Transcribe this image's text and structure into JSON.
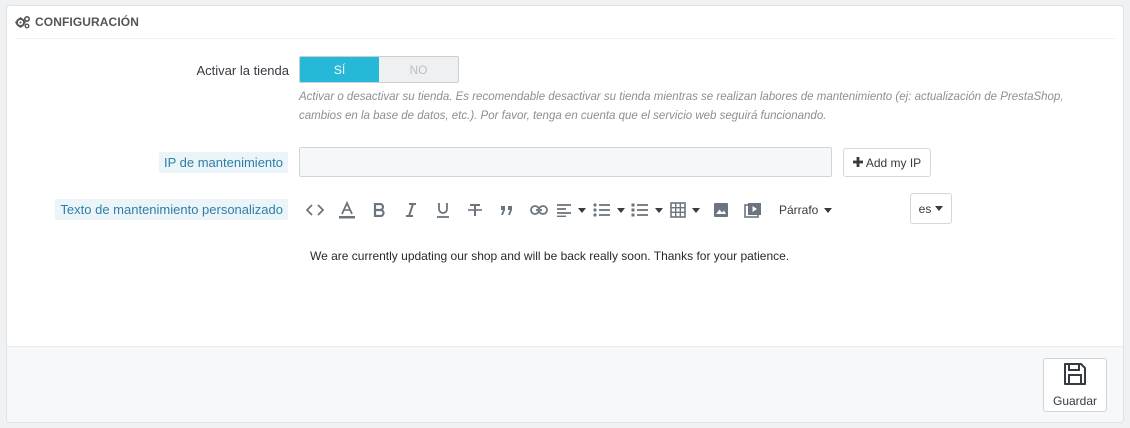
{
  "panel": {
    "title": "CONFIGURACIÓN",
    "title_icon": "cogs-icon"
  },
  "shop_enable": {
    "label": "Activar la tienda",
    "yes_label": "SÍ",
    "no_label": "NO",
    "selected": "yes",
    "help": "Activar o desactivar su tienda. Es recomendable desactivar su tienda mientras se realizan labores de mantenimiento (ej: actualización de PrestaShop, cambios en la base de datos, etc.). Por favor, tenga en cuenta que el servicio web seguirá funcionando."
  },
  "maintenance_ip": {
    "label": "IP de mantenimiento",
    "value": "",
    "add_button_label": "Add my IP",
    "add_button_icon": "plus-icon"
  },
  "maintenance_text": {
    "label": "Texto de mantenimiento personalizado",
    "toolbar": {
      "items": [
        "code-view-icon",
        "text-color-icon",
        "bold-icon",
        "italic-icon",
        "underline-icon",
        "strikethrough-icon",
        "blockquote-icon",
        "link-icon",
        "align-icon",
        "bullet-list-icon",
        "numbered-list-icon",
        "table-icon",
        "image-icon",
        "video-icon"
      ],
      "paragraph_label": "Párrafo"
    },
    "language": "es",
    "content": "We are currently updating our shop and will be back really soon. Thanks for your patience."
  },
  "footer": {
    "save_label": "Guardar",
    "save_icon": "floppy-disk-icon"
  },
  "colors": {
    "accent": "#25b9d7",
    "label_help": "#2e7fa7"
  }
}
